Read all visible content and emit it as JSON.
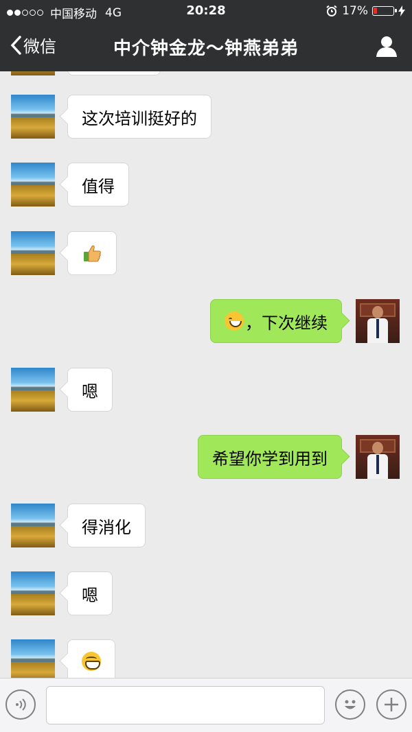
{
  "status_bar": {
    "carrier": "中国移动",
    "network": "4G",
    "time": "20:28",
    "battery": "17%",
    "battery_level": 0.17
  },
  "nav": {
    "back_label": "微信",
    "title": "中介钟金龙～钟燕弟弟"
  },
  "messages": [
    {
      "from": "them",
      "text": "这次培训挺好的"
    },
    {
      "from": "them",
      "text": "值得"
    },
    {
      "from": "them",
      "emoji": "thumbs-up"
    },
    {
      "from": "me",
      "emoji": "grinning-face",
      "text": "，下次继续"
    },
    {
      "from": "them",
      "text": "嗯"
    },
    {
      "from": "me",
      "text": "希望你学到用到"
    },
    {
      "from": "them",
      "text": "得消化"
    },
    {
      "from": "them",
      "text": "嗯"
    },
    {
      "from": "them",
      "emoji": "grinning-face-big-eyes"
    }
  ],
  "input": {
    "value": "",
    "placeholder": ""
  },
  "colors": {
    "nav_bg": "#2e3032",
    "chat_bg": "#ebebeb",
    "outgoing_bubble": "#a0e75a",
    "incoming_bubble": "#ffffff",
    "battery_low": "#e0302a"
  }
}
